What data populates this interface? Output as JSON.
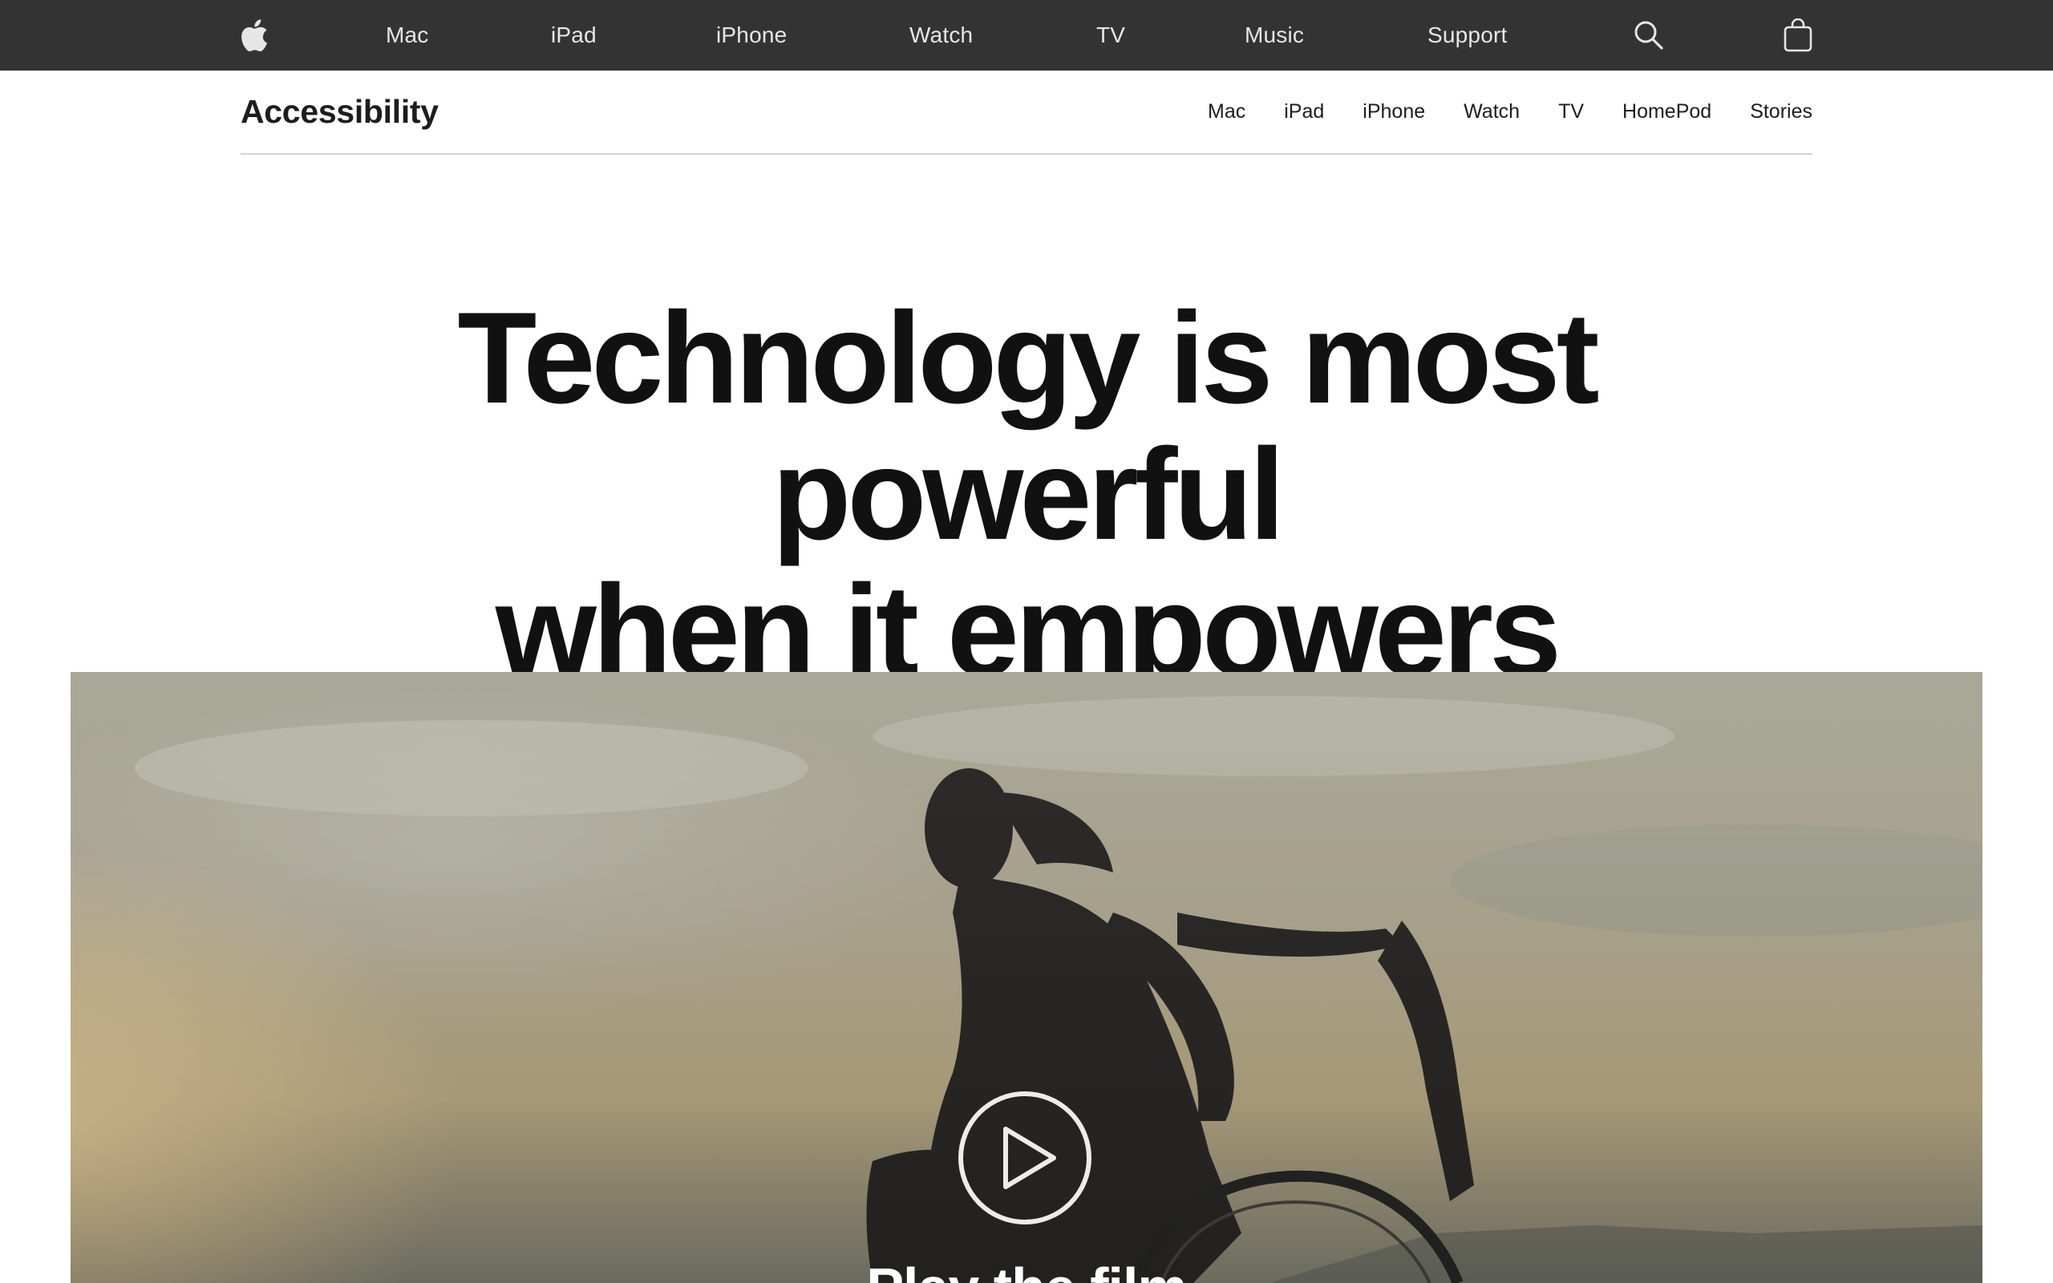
{
  "globalnav": {
    "apple_icon": "apple-logo-icon",
    "items": [
      {
        "label": "Mac"
      },
      {
        "label": "iPad"
      },
      {
        "label": "iPhone"
      },
      {
        "label": "Watch"
      },
      {
        "label": "TV"
      },
      {
        "label": "Music"
      },
      {
        "label": "Support"
      }
    ],
    "search_icon": "search-icon",
    "bag_icon": "shopping-bag-icon"
  },
  "localnav": {
    "title": "Accessibility",
    "links": [
      {
        "label": "Mac"
      },
      {
        "label": "iPad"
      },
      {
        "label": "iPhone"
      },
      {
        "label": "Watch"
      },
      {
        "label": "TV"
      },
      {
        "label": "HomePod"
      },
      {
        "label": "Stories"
      }
    ]
  },
  "hero": {
    "headline_line1": "Technology is most powerful",
    "headline_line2": "when it empowers everyone.",
    "play_icon": "play-circle-icon",
    "play_label": "Play the film"
  },
  "colors": {
    "globalnav_bg": "#333333",
    "globalnav_text": "#e6e6e6",
    "headline": "#111111",
    "divider": "#d2d2d7"
  }
}
